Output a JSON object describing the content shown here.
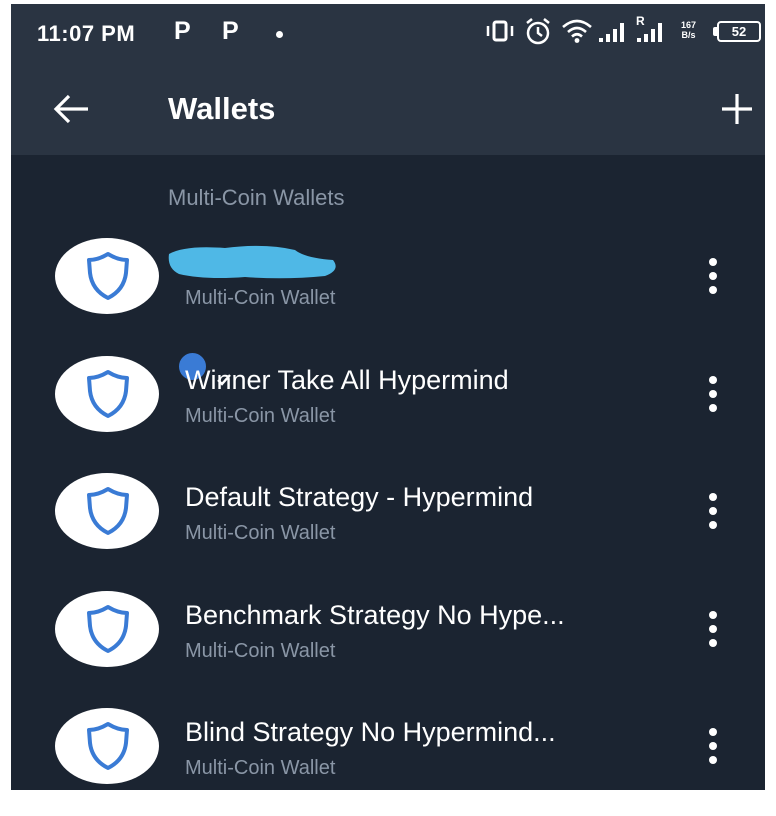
{
  "status_bar": {
    "time": "11:07 PM",
    "notif_1": "P",
    "notif_2": "P",
    "speed_value": "167",
    "speed_unit": "B/s",
    "battery": "52",
    "signal_label": "R"
  },
  "header": {
    "title": "Wallets",
    "back_icon": "arrow-left-icon",
    "add_icon": "plus-icon"
  },
  "section_title": "Multi-Coin Wallets",
  "wallets": [
    {
      "name": "",
      "type": "Multi-Coin Wallet",
      "selected": false,
      "name_redacted": true
    },
    {
      "name": "Winner Take All Hypermind",
      "type": "Multi-Coin Wallet",
      "selected": true
    },
    {
      "name": "Default Strategy - Hypermind",
      "type": "Multi-Coin Wallet",
      "selected": false
    },
    {
      "name": "Benchmark Strategy No Hype...",
      "type": "Multi-Coin Wallet",
      "selected": false
    },
    {
      "name": "Blind Strategy No Hypermind...",
      "type": "Multi-Coin Wallet",
      "selected": false
    }
  ],
  "colors": {
    "background": "#1b2431",
    "topbar": "#2a3442",
    "shield": "#3a7bd5",
    "subtext": "#8a96a6",
    "redaction": "#4fb8e6"
  }
}
